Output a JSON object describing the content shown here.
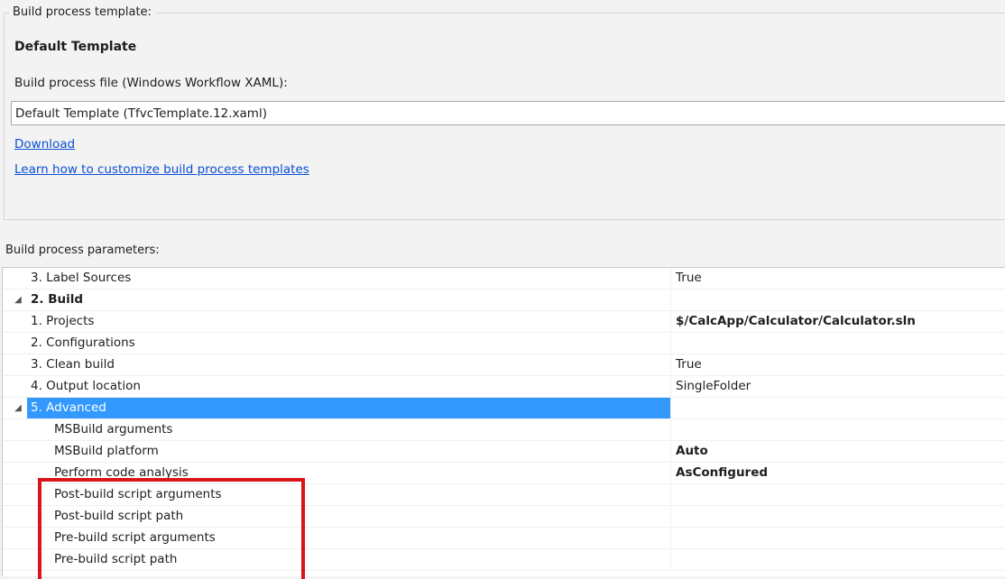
{
  "template_group": {
    "legend": "Build process template:",
    "template_name": "Default Template",
    "file_label": "Build process file (Windows Workflow XAML):",
    "file_value": "Default Template (TfvcTemplate.12.xaml)",
    "download_link": "Download",
    "learn_link": "Learn how to customize build process templates"
  },
  "params_label": "Build process parameters:",
  "grid": {
    "rows": [
      {
        "expander": "",
        "name": "3. Label Sources",
        "value": "True"
      },
      {
        "expander": "◢",
        "name": "2. Build",
        "value": ""
      },
      {
        "expander": "",
        "name": "1. Projects",
        "value": "$/CalcApp/Calculator/Calculator.sln"
      },
      {
        "expander": "",
        "name": "2. Configurations",
        "value": ""
      },
      {
        "expander": "",
        "name": "3. Clean build",
        "value": "True"
      },
      {
        "expander": "",
        "name": "4. Output location",
        "value": "SingleFolder"
      },
      {
        "expander": "◢",
        "name": "5. Advanced",
        "value": ""
      },
      {
        "expander": "",
        "name": "MSBuild arguments",
        "value": ""
      },
      {
        "expander": "",
        "name": "MSBuild platform",
        "value": "Auto"
      },
      {
        "expander": "",
        "name": "Perform code analysis",
        "value": "AsConfigured"
      },
      {
        "expander": "",
        "name": "Post-build script arguments",
        "value": ""
      },
      {
        "expander": "",
        "name": "Post-build script path",
        "value": ""
      },
      {
        "expander": "",
        "name": "Pre-build script arguments",
        "value": ""
      },
      {
        "expander": "",
        "name": "Pre-build script path",
        "value": ""
      }
    ]
  },
  "colors": {
    "selection": "#3399ff",
    "link": "#0a4fd6",
    "highlight": "#d9141b"
  }
}
